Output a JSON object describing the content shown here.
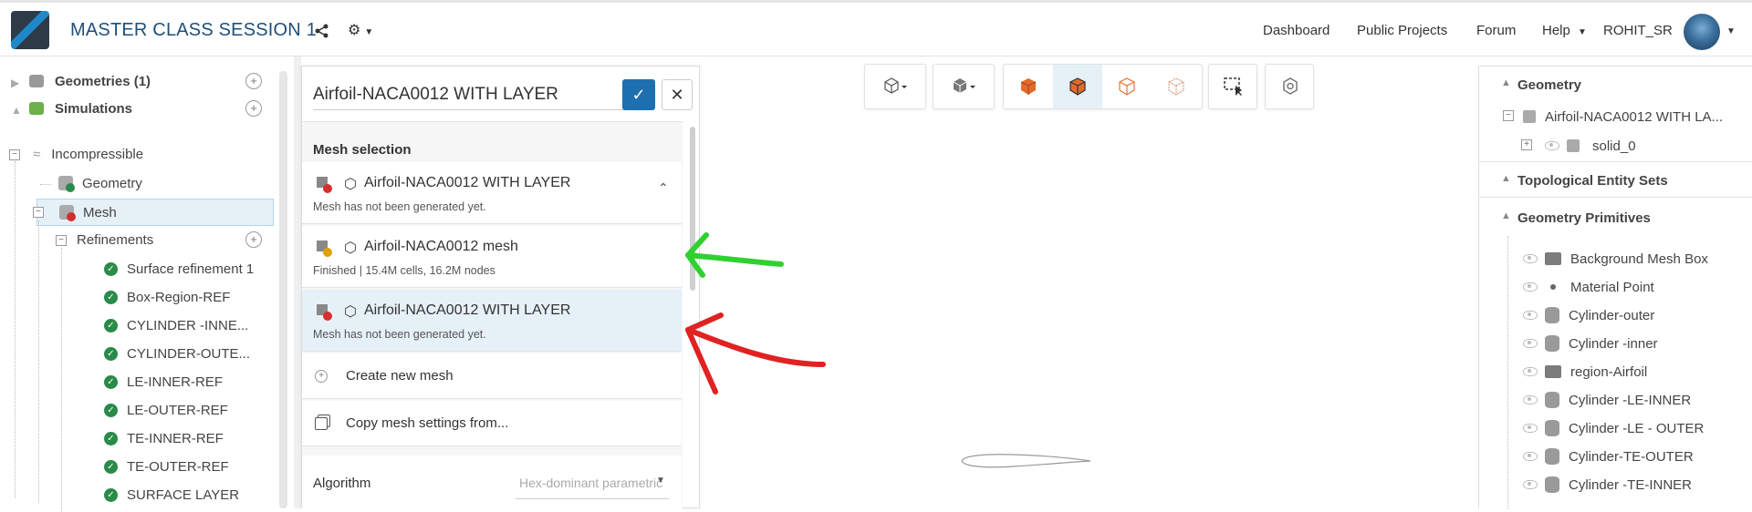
{
  "header": {
    "project_title": "MASTER CLASS SESSION 1",
    "nav": [
      "Dashboard",
      "Public Projects",
      "Forum",
      "Help"
    ],
    "username": "ROHIT_SR"
  },
  "left_tree": {
    "geometries": "Geometries (1)",
    "simulations": "Simulations",
    "incompressible": "Incompressible",
    "geometry": "Geometry",
    "mesh": "Mesh",
    "refinements": "Refinements",
    "refinement_items": [
      "Surface refinement 1",
      "Box-Region-REF",
      "CYLINDER -INNE...",
      "CYLINDER-OUTE...",
      "LE-INNER-REF",
      "LE-OUTER-REF",
      "TE-INNER-REF",
      "TE-OUTER-REF",
      "SURFACE LAYER"
    ]
  },
  "mesh_panel": {
    "name": "Airfoil-NACA0012 WITH LAYER",
    "section_label": "Mesh selection",
    "items": [
      {
        "title": "Airfoil-NACA0012 WITH LAYER",
        "subtitle": "Mesh has not been generated yet."
      },
      {
        "title": "Airfoil-NACA0012 mesh",
        "subtitle": "Finished | 15.4M cells, 16.2M nodes"
      },
      {
        "title": "Airfoil-NACA0012 WITH LAYER",
        "subtitle": "Mesh has not been generated yet."
      }
    ],
    "create_new": "Create new mesh",
    "copy_settings": "Copy mesh settings from...",
    "algorithm_label": "Algorithm",
    "algorithm_value": "Hex-dominant parametric"
  },
  "right_panel": {
    "geometry_head": "Geometry",
    "geometry_item": "Airfoil-NACA0012 WITH LA...",
    "solid": "solid_0",
    "topo_head": "Topological Entity Sets",
    "primitives_head": "Geometry Primitives",
    "primitives": [
      "Background Mesh Box",
      "Material Point",
      "Cylinder-outer",
      "Cylinder -inner",
      "region-Airfoil",
      "Cylinder -LE-INNER",
      "Cylinder -LE - OUTER",
      "Cylinder-TE-OUTER",
      "Cylinder -TE-INNER"
    ]
  },
  "colors": {
    "accent": "#1e6fb0",
    "success": "#2a8a4a",
    "error": "#d32f2f",
    "warning": "#e0a000",
    "arrow_green": "#2fd12f",
    "arrow_red": "#e02222"
  }
}
